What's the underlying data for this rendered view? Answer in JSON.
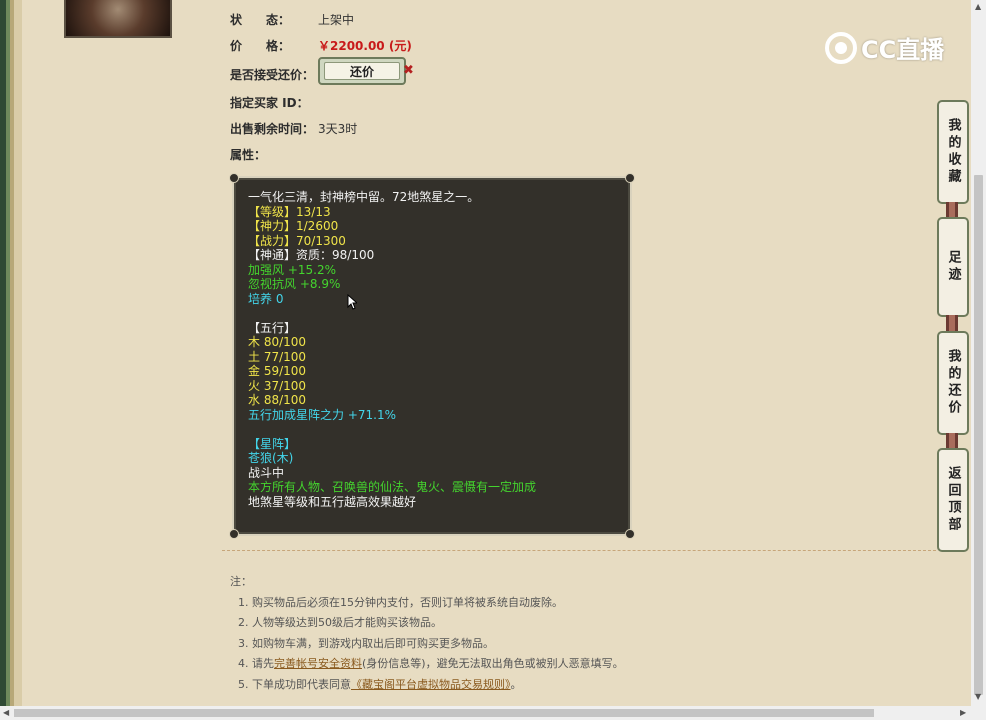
{
  "item": {
    "status_label": "状　　态：",
    "status_value": "上架中",
    "price_label": "价　　格：",
    "price_value": "￥2200.00 (元)",
    "counter_label": "是否接受还价：",
    "counter_button": "还价",
    "counter_x": "✖",
    "buyer_label": "指定买家 ID：",
    "time_label": "出售剩余时间：",
    "time_value": "3天3时",
    "attr_label": "属性："
  },
  "tooltip": {
    "lines": [
      {
        "text": "一气化三清，封神榜中留。72地煞星之一。",
        "color": "white"
      },
      {
        "text": "【等级】13/13",
        "color": "yellow"
      },
      {
        "text": "【神力】1/2600",
        "color": "yellow"
      },
      {
        "text": "【战力】70/1300",
        "color": "yellow"
      },
      {
        "text": "【神通】资质：98/100",
        "color": "white"
      },
      {
        "text": "加强风 +15.2%",
        "color": "green"
      },
      {
        "text": "忽视抗风 +8.9%",
        "color": "green"
      },
      {
        "text": "培养 0",
        "color": "cyan"
      },
      {
        "text": "",
        "color": "white"
      },
      {
        "text": "【五行】",
        "color": "white"
      },
      {
        "text": "木 80/100",
        "color": "yellow"
      },
      {
        "text": "土 77/100",
        "color": "yellow"
      },
      {
        "text": "金 59/100",
        "color": "yellow"
      },
      {
        "text": "火 37/100",
        "color": "yellow"
      },
      {
        "text": "水 88/100",
        "color": "yellow"
      },
      {
        "text": "五行加成星阵之力 +71.1%",
        "color": "cyan"
      },
      {
        "text": "",
        "color": "white"
      },
      {
        "text": "【星阵】",
        "color": "cyan"
      },
      {
        "text": "苍狼(木)",
        "color": "cyan"
      },
      {
        "text": "战斗中",
        "color": "white"
      },
      {
        "text": "本方所有人物、召唤兽的仙法、鬼火、震慑有一定加成",
        "color": "green"
      },
      {
        "text": "地煞星等级和五行越高效果越好",
        "color": "white"
      }
    ]
  },
  "notes": {
    "title": "注：",
    "items": [
      "1. 购买物品后必须在15分钟内支付，否则订单将被系统自动废除。",
      "2. 人物等级达到50级后才能购买该物品。",
      "3. 如购物车满，到游戏内取出后即可购买更多物品。"
    ],
    "item4_prefix": "4. 请先",
    "item4_link": "完善帐号安全资料",
    "item4_suffix": "(身份信息等)，避免无法取出角色或被别人恶意填写。",
    "item5_prefix": "5. 下单成功即代表同意",
    "item5_link": "《藏宝阁平台虚拟物品交易规则》",
    "item5_suffix": "。"
  },
  "side_nav": [
    "我的收藏",
    "足迹",
    "我的还价",
    "返回顶部"
  ],
  "logo": {
    "text": "CC直播"
  },
  "colors": {
    "price": "#c81a1a",
    "bg": "#e7dcc2",
    "tooltip_bg": "#33302a"
  }
}
